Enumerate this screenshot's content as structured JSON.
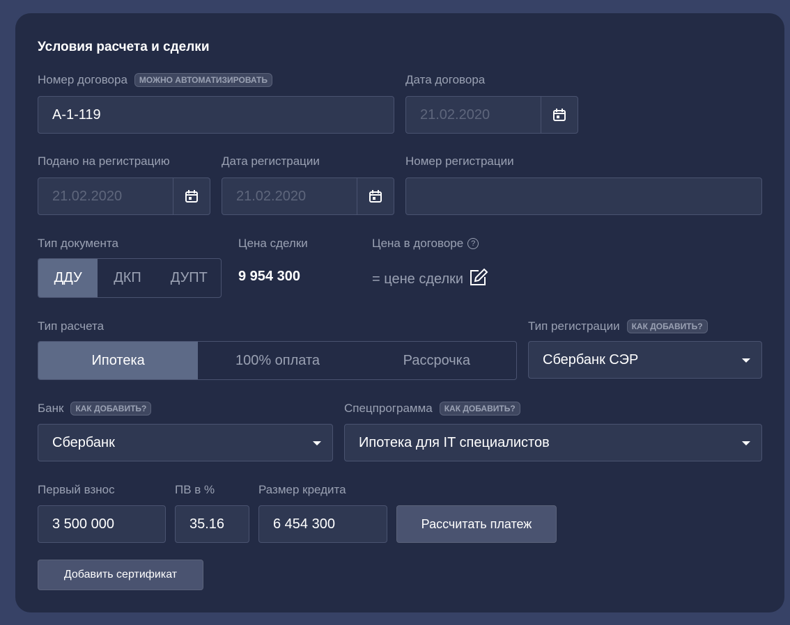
{
  "title": "Условия расчета и сделки",
  "contract_number": {
    "label": "Номер договора",
    "badge": "Можно автоматизировать",
    "value": "А-1-119"
  },
  "contract_date": {
    "label": "Дата договора",
    "placeholder": "21.02.2020"
  },
  "submitted": {
    "label": "Подано на регистрацию",
    "placeholder": "21.02.2020"
  },
  "reg_date": {
    "label": "Дата регистрации",
    "placeholder": "21.02.2020"
  },
  "reg_number": {
    "label": "Номер регистрации",
    "value": ""
  },
  "doc_type": {
    "label": "Тип документа",
    "options": [
      "ДДУ",
      "ДКП",
      "ДУПТ"
    ],
    "selected": "ДДУ"
  },
  "deal_price": {
    "label": "Цена сделки",
    "value": "9 954 300"
  },
  "contract_price": {
    "label": "Цена в договоре",
    "value": "= цене сделки"
  },
  "calc_type": {
    "label": "Тип расчета",
    "options": [
      "Ипотека",
      "100% оплата",
      "Рассрочка"
    ],
    "selected": "Ипотека"
  },
  "reg_type": {
    "label": "Тип регистрации",
    "badge": "Как добавить?",
    "value": "Сбербанк СЭР"
  },
  "bank": {
    "label": "Банк",
    "badge": "Как добавить?",
    "value": "Сбербанк"
  },
  "program": {
    "label": "Спецпрограмма",
    "badge": "Как добавить?",
    "value": "Ипотека для IT специалистов"
  },
  "down_payment": {
    "label": "Первый взнос",
    "value": "3 500 000"
  },
  "dp_percent": {
    "label": "ПВ в %",
    "value": "35.16"
  },
  "credit": {
    "label": "Размер кредита",
    "value": "6 454 300"
  },
  "calc_button": "Рассчитать платеж",
  "add_cert_button": "Добавить сертификат"
}
